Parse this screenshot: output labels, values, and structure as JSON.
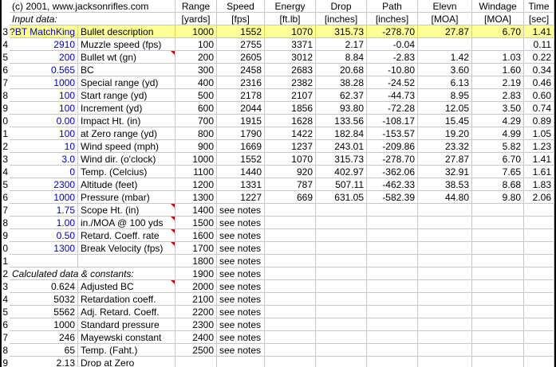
{
  "header": {
    "copyright": "(c) 2001, www.jacksonrifles.com",
    "input_title": "Input data:",
    "calc_title": "Calculated data & constants:",
    "columns": [
      {
        "top": "Range",
        "bottom": "[yards]"
      },
      {
        "top": "Speed",
        "bottom": "[fps]"
      },
      {
        "top": "Energy",
        "bottom": "[ft.lb]"
      },
      {
        "top": "Drop",
        "bottom": "[inches]"
      },
      {
        "top": "Path",
        "bottom": "[inches]"
      },
      {
        "top": "Elevn",
        "bottom": "[MOA]"
      },
      {
        "top": "Windage",
        "bottom": "[MOA]"
      },
      {
        "top": "Time",
        "bottom": "[sec]"
      }
    ]
  },
  "row_numbers": [
    "",
    "",
    "3",
    "4",
    "5",
    "6",
    "7",
    "8",
    "9",
    "0",
    "1",
    "2",
    "3",
    "4",
    "5",
    "6",
    "7",
    "8",
    "9",
    "0",
    "1",
    "2",
    "3",
    "4",
    "5",
    "6",
    "7",
    "8",
    "9"
  ],
  "inputs": [
    {
      "value": "?BT MatchKing",
      "label": "Bullet description",
      "flag": false
    },
    {
      "value": "2910",
      "label": "Muzzle speed (fps)",
      "flag": false
    },
    {
      "value": "200",
      "label": "Bullet wt (gn)",
      "flag": true
    },
    {
      "value": "0.565",
      "label": "BC",
      "flag": false
    },
    {
      "value": "1000",
      "label": "Special range (yd)",
      "flag": false
    },
    {
      "value": "100",
      "label": "Start range (yd)",
      "flag": false
    },
    {
      "value": "100",
      "label": "Increment (yd)",
      "flag": false
    },
    {
      "value": "0.00",
      "label": "Impact Ht. (in)",
      "flag": false
    },
    {
      "value": "100",
      "label": "at Zero range (yd)",
      "flag": false
    },
    {
      "value": "10",
      "label": "Wind speed (mph)",
      "flag": false
    },
    {
      "value": "3.0",
      "label": "Wind dir. (o'clock)",
      "flag": false
    },
    {
      "value": "0",
      "label": "Temp. (Celcius)",
      "flag": false
    },
    {
      "value": "2300",
      "label": "Altitude (feet)",
      "flag": false
    },
    {
      "value": "1000",
      "label": "Pressure (mbar)",
      "flag": false
    },
    {
      "value": "1.75",
      "label": "Scope Ht. (in)",
      "flag": true
    },
    {
      "value": "1.00",
      "label": "in./MOA @ 100 yds",
      "flag": true
    },
    {
      "value": "0.50",
      "label": "Retard. Coeff. rate",
      "flag": true
    },
    {
      "value": "1300",
      "label": "Break Velocity (fps)",
      "flag": true
    }
  ],
  "calculated": [
    {
      "value": "0.624",
      "label": "Adjusted BC",
      "flag": true
    },
    {
      "value": "5032",
      "label": "Retardation coeff.",
      "flag": false
    },
    {
      "value": "5562",
      "label": "Adj. Retard. Coeff.",
      "flag": false
    },
    {
      "value": "1000",
      "label": "Standard pressure",
      "flag": false
    },
    {
      "value": "246",
      "label": "Mayewski constant",
      "flag": false
    },
    {
      "value": "65",
      "label": "Temp. (Faht.)",
      "flag": false
    },
    {
      "value": "2.13",
      "label": "Drop at Zero",
      "flag": false
    }
  ],
  "table": [
    [
      "1000",
      "1552",
      "1070",
      "315.73",
      "-278.70",
      "27.87",
      "6.70",
      "1.41"
    ],
    [
      "100",
      "2755",
      "3371",
      "2.17",
      "-0.04",
      "",
      "",
      "0.11"
    ],
    [
      "200",
      "2605",
      "3012",
      "8.84",
      "-2.83",
      "1.42",
      "1.03",
      "0.22"
    ],
    [
      "300",
      "2458",
      "2683",
      "20.68",
      "-10.80",
      "3.60",
      "1.60",
      "0.34"
    ],
    [
      "400",
      "2316",
      "2382",
      "38.28",
      "-24.52",
      "6.13",
      "2.19",
      "0.46"
    ],
    [
      "500",
      "2178",
      "2107",
      "62.37",
      "-44.73",
      "8.95",
      "2.83",
      "0.60"
    ],
    [
      "600",
      "2044",
      "1856",
      "93.80",
      "-72.28",
      "12.05",
      "3.50",
      "0.74"
    ],
    [
      "700",
      "1915",
      "1628",
      "133.56",
      "-108.17",
      "15.45",
      "4.29",
      "0.89"
    ],
    [
      "800",
      "1790",
      "1422",
      "182.84",
      "-153.57",
      "19.20",
      "4.99",
      "1.05"
    ],
    [
      "900",
      "1669",
      "1237",
      "243.01",
      "-209.86",
      "23.32",
      "5.82",
      "1.23"
    ],
    [
      "1000",
      "1552",
      "1070",
      "315.73",
      "-278.70",
      "27.87",
      "6.70",
      "1.41"
    ],
    [
      "1100",
      "1440",
      "920",
      "402.97",
      "-362.06",
      "32.91",
      "7.65",
      "1.61"
    ],
    [
      "1200",
      "1331",
      "787",
      "507.11",
      "-462.33",
      "38.53",
      "8.68",
      "1.83"
    ],
    [
      "1300",
      "1227",
      "669",
      "631.05",
      "-582.39",
      "44.80",
      "9.80",
      "2.06"
    ],
    [
      "1400",
      "see notes",
      "",
      "",
      "",
      "",
      "",
      ""
    ],
    [
      "1500",
      "see notes",
      "",
      "",
      "",
      "",
      "",
      ""
    ],
    [
      "1600",
      "see notes",
      "",
      "",
      "",
      "",
      "",
      ""
    ],
    [
      "1700",
      "see notes",
      "",
      "",
      "",
      "",
      "",
      ""
    ],
    [
      "1800",
      "see notes",
      "",
      "",
      "",
      "",
      "",
      ""
    ],
    [
      "1900",
      "see notes",
      "",
      "",
      "",
      "",
      "",
      ""
    ],
    [
      "2000",
      "see notes",
      "",
      "",
      "",
      "",
      "",
      ""
    ],
    [
      "2100",
      "see notes",
      "",
      "",
      "",
      "",
      "",
      ""
    ],
    [
      "2200",
      "see notes",
      "",
      "",
      "",
      "",
      "",
      ""
    ],
    [
      "2300",
      "see notes",
      "",
      "",
      "",
      "",
      "",
      ""
    ],
    [
      "2400",
      "see notes",
      "",
      "",
      "",
      "",
      "",
      ""
    ],
    [
      "2500",
      "see notes",
      "",
      "",
      "",
      "",
      "",
      ""
    ]
  ],
  "colors": {
    "input_blue": "#0000c8",
    "highlight_yellow": "#ffff99",
    "comment_red": "#d00000",
    "gridline": "#c8c8c8"
  }
}
